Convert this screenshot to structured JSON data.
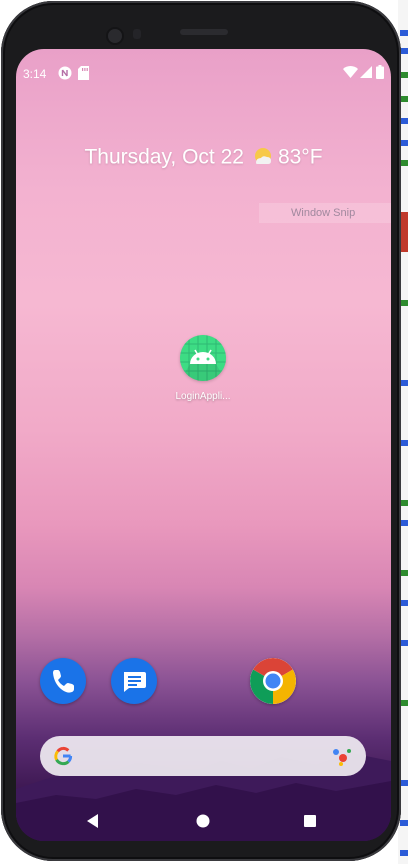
{
  "status_bar": {
    "time": "3:14",
    "left_icons": [
      "nfc-icon",
      "sd-card-icon"
    ],
    "right_icons": [
      "wifi-icon",
      "signal-icon",
      "battery-icon"
    ]
  },
  "glance": {
    "date": "Thursday, Oct 22",
    "weather_icon": "partly-sunny-icon",
    "temperature": "83°F"
  },
  "background_window": {
    "title": "Window Snip"
  },
  "home_apps": [
    {
      "label": "LoginAppli...",
      "icon": "android-icon"
    }
  ],
  "dock": [
    {
      "name": "phone",
      "icon": "phone-icon"
    },
    {
      "name": "messages",
      "icon": "messages-icon"
    },
    {
      "name": "chrome",
      "icon": "chrome-icon"
    }
  ],
  "search": {
    "logo": "google-icon",
    "mic": "assistant-icon"
  },
  "nav": {
    "back": "back-icon",
    "home": "home-icon",
    "recents": "recents-icon"
  },
  "colors": {
    "android_green": "#3ddc84",
    "dock_blue": "#1a73e8",
    "wallpaper_top": "#e9a0c8",
    "wallpaper_bottom": "#320f48"
  }
}
